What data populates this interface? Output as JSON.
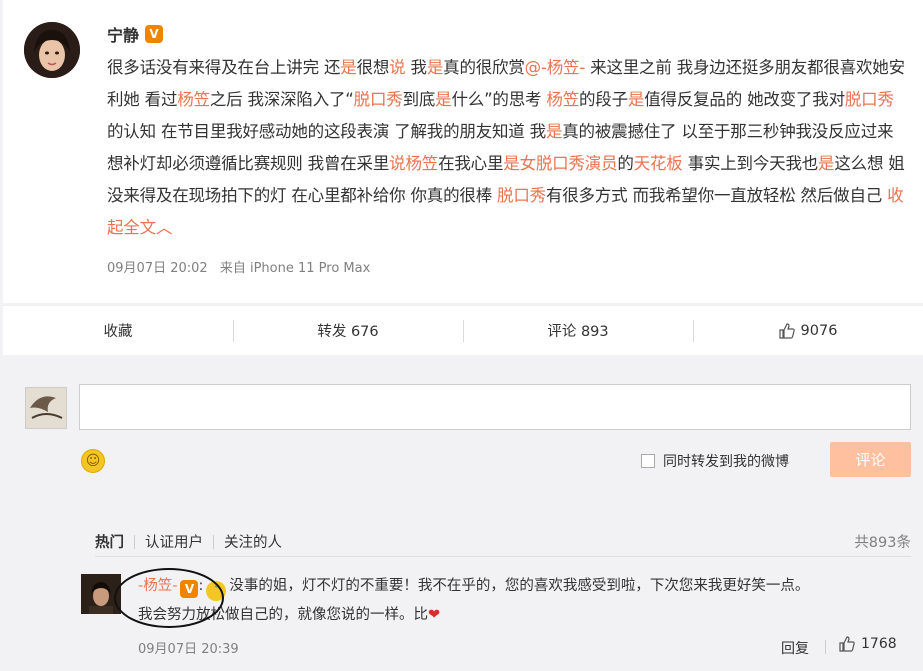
{
  "post": {
    "author": "宁静",
    "verified_badge": "V",
    "text_segments": [
      {
        "t": "很多话没有来得及在台上讲完 还"
      },
      {
        "t": "是",
        "hl": true
      },
      {
        "t": "很想"
      },
      {
        "t": "说",
        "hl": true
      },
      {
        "t": " 我"
      },
      {
        "t": "是",
        "hl": true
      },
      {
        "t": "真的很欣赏"
      },
      {
        "t": "@-杨笠-",
        "hl": true
      },
      {
        "t": " 来这里之前 我身边还挺多朋友都很喜欢她安利她 看过"
      },
      {
        "t": "杨笠",
        "hl": true
      },
      {
        "t": "之后 我深深陷入了“"
      },
      {
        "t": "脱口秀",
        "hl": true
      },
      {
        "t": "到底"
      },
      {
        "t": "是",
        "hl": true
      },
      {
        "t": "什么”的思考 "
      },
      {
        "t": "杨笠",
        "hl": true
      },
      {
        "t": "的段子"
      },
      {
        "t": "是",
        "hl": true
      },
      {
        "t": "值得反复品的 她改变了我对"
      },
      {
        "t": "脱口秀",
        "hl": true
      },
      {
        "t": "的认知 在节目里我好感动她的这段表演 了解我的朋友知道 我"
      },
      {
        "t": "是",
        "hl": true
      },
      {
        "t": "真的被震撼住了 以至于那三秒钟我没反应过来 想补灯却必须遵循比赛规则 我曾在采里"
      },
      {
        "t": "说杨笠",
        "hl": true
      },
      {
        "t": "在我心里"
      },
      {
        "t": "是女脱口秀演员",
        "hl": true
      },
      {
        "t": "的"
      },
      {
        "t": "天花板",
        "hl": true
      },
      {
        "t": " 事实上到今天我也"
      },
      {
        "t": "是",
        "hl": true
      },
      {
        "t": "这么想 姐没来得及在现场拍下的灯 在心里都补给你 你真的很棒 "
      },
      {
        "t": "脱口秀",
        "hl": true
      },
      {
        "t": "有很多方式 而我希望你一直放轻松 然后做自己 "
      }
    ],
    "collapse_label": "收起全文",
    "collapse_icon": "chevron-up-icon",
    "time": "09月07日 20:02",
    "source": "来自 iPhone 11 Pro Max"
  },
  "actions": {
    "favorite": "收藏",
    "repost": "转发 676",
    "comment": "评论 893",
    "like_count": "9076"
  },
  "composer": {
    "forward_label": "同时转发到我的微博",
    "submit_label": "评论"
  },
  "comment_tabs": [
    "热门",
    "认证用户",
    "关注的人"
  ],
  "comment_total": "共893条",
  "top_comment": {
    "user": "-杨笠-",
    "verified_badge": "V",
    "text_line1": "没事的姐，灯不灯的不重要！我不在乎的，您的喜欢我感受到啦，下次您来我更好笑一点。",
    "text_line2": "我会努力放松做自己的，就像您说的一样。比",
    "heart": "❤",
    "time": "09月07日 20:39",
    "reply_label": "回复",
    "like_count": "1768"
  },
  "colors": {
    "accent": "#eb7350",
    "badge": "#f08300",
    "submit_disabled": "#ffc09f"
  }
}
